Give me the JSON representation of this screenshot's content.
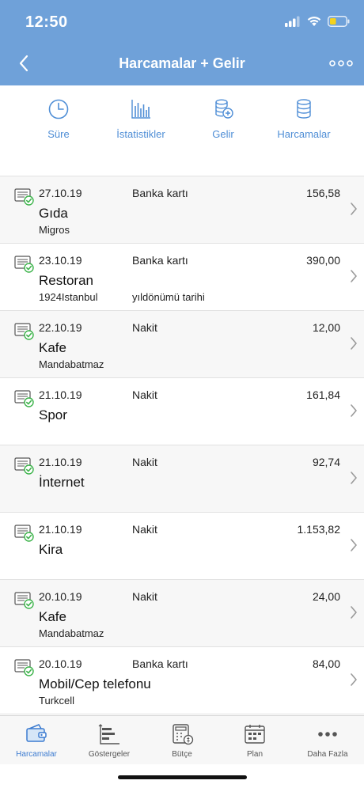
{
  "status_bar": {
    "time": "12:50"
  },
  "nav": {
    "title": "Harcamalar + Gelir"
  },
  "toolbar": [
    {
      "label": "Süre",
      "icon": "clock-icon"
    },
    {
      "label": "İstatistikler",
      "icon": "bar-chart-icon"
    },
    {
      "label": "Gelir",
      "icon": "coins-plus-icon"
    },
    {
      "label": "Harcamalar",
      "icon": "coins-icon"
    }
  ],
  "transactions": [
    {
      "date": "27.10.19",
      "method": "Banka kartı",
      "amount": "156,58",
      "category": "Gıda",
      "payee": "Migros",
      "note": ""
    },
    {
      "date": "23.10.19",
      "method": "Banka kartı",
      "amount": "390,00",
      "category": "Restoran",
      "payee": "1924Istanbul",
      "note": "yıldönümü tarihi"
    },
    {
      "date": "22.10.19",
      "method": "Nakit",
      "amount": "12,00",
      "category": "Kafe",
      "payee": "Mandabatmaz",
      "note": ""
    },
    {
      "date": "21.10.19",
      "method": "Nakit",
      "amount": "161,84",
      "category": "Spor",
      "payee": "",
      "note": ""
    },
    {
      "date": "21.10.19",
      "method": "Nakit",
      "amount": "92,74",
      "category": "İnternet",
      "payee": "",
      "note": ""
    },
    {
      "date": "21.10.19",
      "method": "Nakit",
      "amount": "1.153,82",
      "category": "Kira",
      "payee": "",
      "note": ""
    },
    {
      "date": "20.10.19",
      "method": "Nakit",
      "amount": "24,00",
      "category": "Kafe",
      "payee": "Mandabatmaz",
      "note": ""
    },
    {
      "date": "20.10.19",
      "method": "Banka kartı",
      "amount": "84,00",
      "category": "Mobil/Cep telefonu",
      "payee": "Turkcell",
      "note": ""
    }
  ],
  "tabbar": [
    {
      "label": "Harcamalar",
      "icon": "wallet-icon",
      "active": true
    },
    {
      "label": "Göstergeler",
      "icon": "gantt-chart-icon",
      "active": false
    },
    {
      "label": "Bütçe",
      "icon": "budget-calculator-icon",
      "active": false
    },
    {
      "label": "Plan",
      "icon": "calendar-icon",
      "active": false
    },
    {
      "label": "Daha Fazla",
      "icon": "more-dots-icon",
      "active": false
    }
  ],
  "colors": {
    "header": "#6fa1d9",
    "accent": "#4f8ed6",
    "check": "#3cb34a",
    "battery": "#f5d21c"
  }
}
